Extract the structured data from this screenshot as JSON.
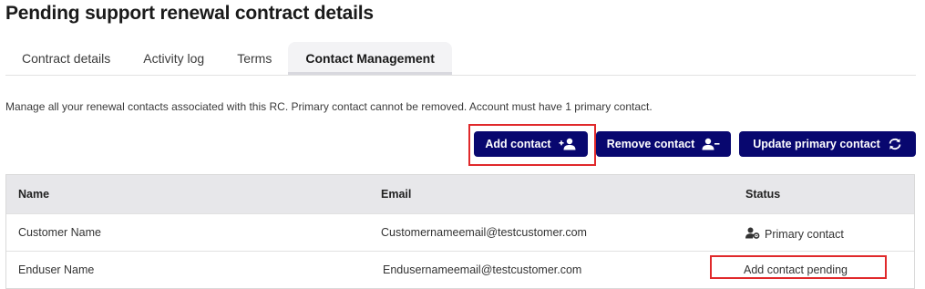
{
  "page": {
    "title": "Pending support renewal contract details"
  },
  "tabs": [
    {
      "label": "Contract details",
      "active": false
    },
    {
      "label": "Activity log",
      "active": false
    },
    {
      "label": "Terms",
      "active": false
    },
    {
      "label": "Contact Management",
      "active": true
    }
  ],
  "description": "Manage all your renewal contacts associated with this RC. Primary contact cannot be removed. Account must have 1 primary contact.",
  "toolbar": {
    "add_label": "Add contact",
    "add_icon": "add-user-icon",
    "remove_label": "Remove contact",
    "remove_icon": "remove-user-icon",
    "update_label": "Update primary contact",
    "update_icon": "sync-icon"
  },
  "table": {
    "headers": {
      "name": "Name",
      "email": "Email",
      "status": "Status"
    },
    "rows": [
      {
        "name": "Customer Name",
        "email": "Customernameemail@testcustomer.com",
        "status": "Primary contact",
        "status_icon": "user-settings-icon"
      },
      {
        "name": "Enduser Name",
        "email": "Endusernameemail@testcustomer.com",
        "status": "Add contact pending"
      }
    ]
  },
  "colors": {
    "accent": "#08076f",
    "highlight": "#e0292b",
    "header_bg": "#e7e7ea"
  }
}
